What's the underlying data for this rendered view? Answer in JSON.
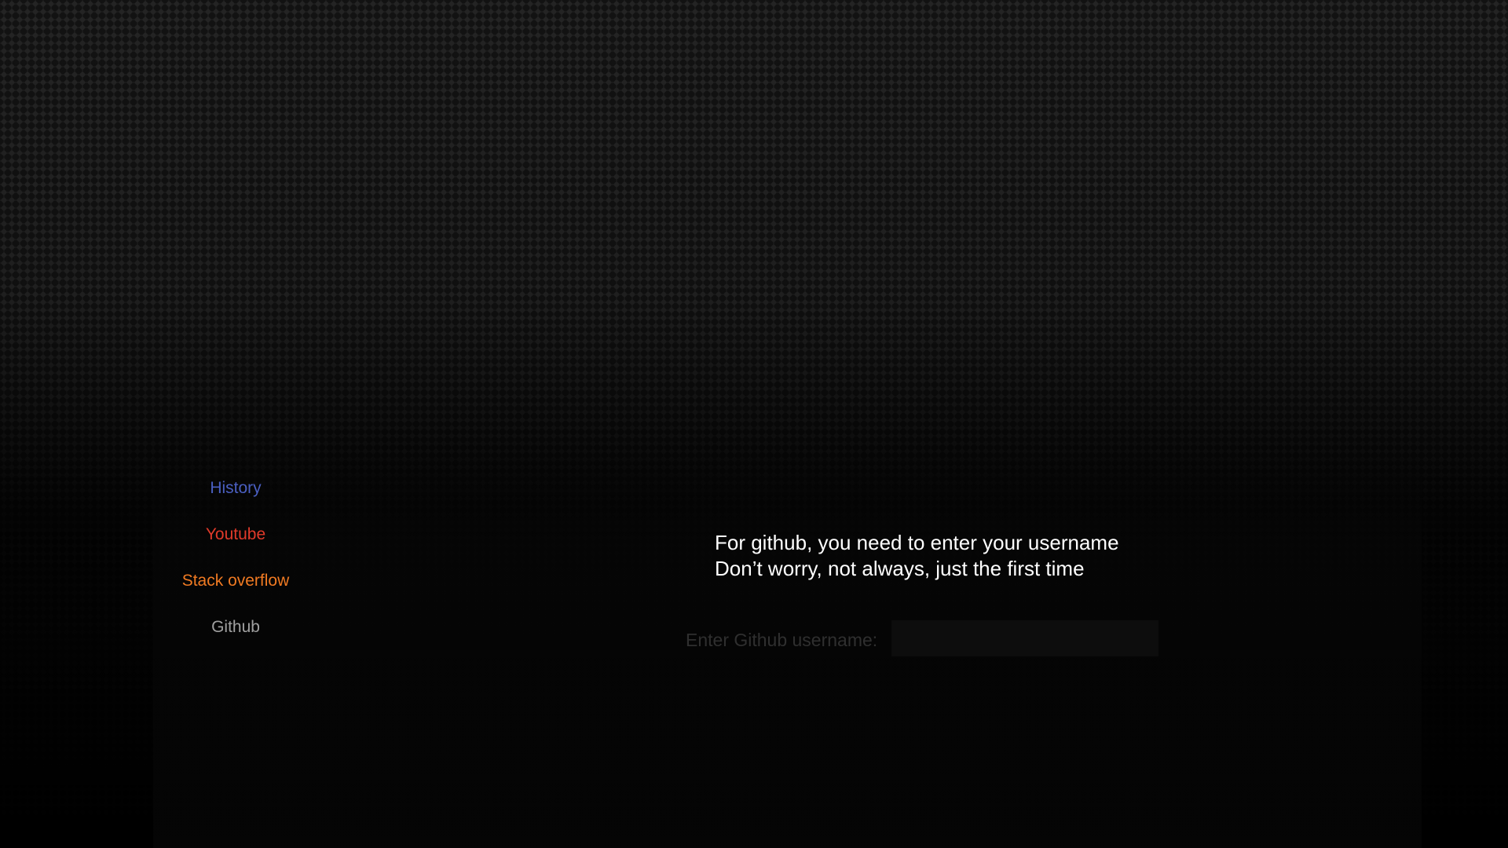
{
  "sidebar": {
    "items": [
      {
        "label": "History",
        "color": "#4a5fc1"
      },
      {
        "label": "Youtube",
        "color": "#e03a2a"
      },
      {
        "label": "Stack overflow",
        "color": "#f07a22"
      },
      {
        "label": "Github",
        "color": "#a0a0a0"
      }
    ]
  },
  "main": {
    "message_line1": "For github, you need to enter your username",
    "message_line2": "Don’t worry, not always, just the first time",
    "username_label": "Enter Github username:",
    "username_value": "",
    "username_placeholder": ""
  },
  "colors": {
    "background": "#1c1c1c",
    "message_text": "#ffffff",
    "label_text": "#2f2f2f"
  }
}
